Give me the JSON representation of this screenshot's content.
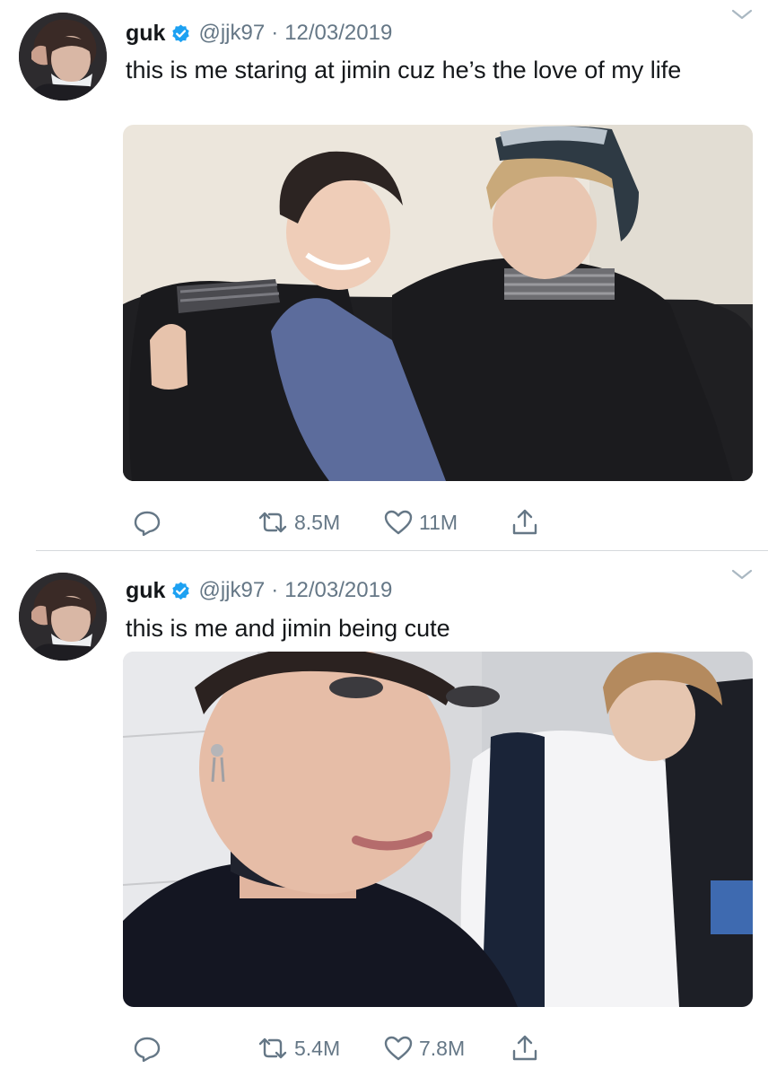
{
  "colors": {
    "text": "#14171a",
    "secondary": "#657786",
    "verified": "#1da1f2",
    "divider": "#d6d9dc"
  },
  "tweets": [
    {
      "author": {
        "name": "guk",
        "handle": "@jjk97",
        "verified": true
      },
      "separator": "·",
      "date": "12/03/2019",
      "text": "this is me staring at jimin cuz he’s the love of my life",
      "media": "photo of two people sitting on a couch",
      "stats": {
        "retweets": "8.5M",
        "likes": "11M"
      },
      "icons": [
        "chevron-down-icon",
        "reply-icon",
        "retweet-icon",
        "like-icon",
        "share-icon"
      ]
    },
    {
      "author": {
        "name": "guk",
        "handle": "@jjk97",
        "verified": true
      },
      "separator": "·",
      "date": "12/03/2019",
      "text": "this is me and jimin being cute",
      "media": "selfie photo of two people",
      "stats": {
        "retweets": "5.4M",
        "likes": "7.8M"
      },
      "icons": [
        "chevron-down-icon",
        "reply-icon",
        "retweet-icon",
        "like-icon",
        "share-icon"
      ]
    }
  ]
}
